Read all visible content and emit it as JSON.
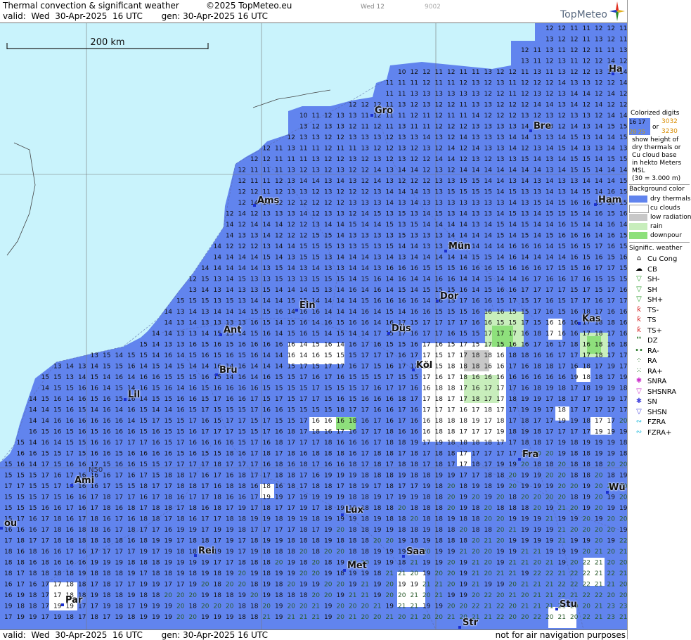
{
  "header": {
    "title": "Thermal convection & significant weather",
    "copyright": "©2025 TopMeteo.eu",
    "valid_line": "valid:  Wed  30-Apr-2025  16 UTC       gen: 30-Apr-2025 16 UTC",
    "tag_a": "Wed 12",
    "tag_b": "9002",
    "logo_text": "TopMeteo"
  },
  "map": {
    "scale_label": "200 km",
    "grid_label": "N50",
    "cities": [
      {
        "id": "gro",
        "name": "Gro"
      },
      {
        "id": "bre",
        "name": "Bre"
      },
      {
        "id": "ha",
        "name": "Ha"
      },
      {
        "id": "ams",
        "name": "Ams"
      },
      {
        "id": "ham",
        "name": "Ham"
      },
      {
        "id": "mun",
        "name": "Mün"
      },
      {
        "id": "dor",
        "name": "Dor"
      },
      {
        "id": "ein",
        "name": "Ein"
      },
      {
        "id": "kas",
        "name": "Kas"
      },
      {
        "id": "ant",
        "name": "Ant"
      },
      {
        "id": "dus",
        "name": "Düs"
      },
      {
        "id": "kol",
        "name": "Köl"
      },
      {
        "id": "bru",
        "name": "Bru"
      },
      {
        "id": "lil",
        "name": "Lil"
      },
      {
        "id": "fra",
        "name": "Fra"
      },
      {
        "id": "ami",
        "name": "Ami"
      },
      {
        "id": "wu",
        "name": "Wü"
      },
      {
        "id": "lux",
        "name": "Lux"
      },
      {
        "id": "rei",
        "name": "Rei"
      },
      {
        "id": "saa",
        "name": "Saa"
      },
      {
        "id": "met",
        "name": "Met"
      },
      {
        "id": "par",
        "name": "Par"
      },
      {
        "id": "stu",
        "name": "Stu"
      },
      {
        "id": "str",
        "name": "Str"
      },
      {
        "id": "ou",
        "name": "ou"
      }
    ]
  },
  "footer": {
    "valid_line": "valid:  Wed  30-Apr-2025  16 UTC       gen: 30-Apr-2025 16 UTC",
    "disclaimer": "not for air navigation purposes"
  },
  "legend": {
    "digits_title": "Colorized digits",
    "digit_sample_a": "16  17",
    "digit_sample_b": "28 25",
    "digit_or": "or",
    "digit_orange_a": "3032",
    "digit_orange_b": "3230",
    "digits_desc": [
      "show height of",
      "dry thermals or",
      "Cu cloud base",
      "in hekto Meters",
      "MSL",
      "(30 = 3.000 m)"
    ],
    "bg_title": "Background color",
    "bg_items": [
      {
        "label": "dry thermals",
        "color": "#6184ee"
      },
      {
        "label": "cu clouds",
        "color": "#ffffff"
      },
      {
        "label": "low radiation",
        "color": "#c8c8c8"
      },
      {
        "label": "rain",
        "color": "#c8eebc"
      },
      {
        "label": "downpour",
        "color": "#8ee07c"
      }
    ],
    "wx_title": "Signific. weather",
    "wx_items": [
      {
        "label": "Cu Cong",
        "symbol": "⌂",
        "color": "#000000"
      },
      {
        "label": "CB",
        "symbol": "☁",
        "color": "#000000"
      },
      {
        "label": "SH-",
        "symbol": "▽",
        "color": "#2d9d2d"
      },
      {
        "label": "SH",
        "symbol": "▽",
        "color": "#2d9d2d"
      },
      {
        "label": "SH+",
        "symbol": "▽",
        "color": "#2d9d2d"
      },
      {
        "label": "TS-",
        "symbol": "ƙ",
        "color": "#d42020"
      },
      {
        "label": "TS",
        "symbol": "ƙ",
        "color": "#d42020"
      },
      {
        "label": "TS+",
        "symbol": "ƙ",
        "color": "#d42020"
      },
      {
        "label": "DZ",
        "symbol": "❜❜",
        "color": "#1a6e1a"
      },
      {
        "label": "RA-",
        "symbol": "••",
        "color": "#1a6e1a"
      },
      {
        "label": "RA",
        "symbol": "⁘",
        "color": "#1a6e1a"
      },
      {
        "label": "RA+",
        "symbol": "⁙",
        "color": "#1a6e1a"
      },
      {
        "label": "SNRA",
        "symbol": "✱",
        "color": "#cc33cc"
      },
      {
        "label": "SHSNRA",
        "symbol": "▽",
        "color": "#cc33cc"
      },
      {
        "label": "SN",
        "symbol": "✱",
        "color": "#4444dd"
      },
      {
        "label": "SHSN",
        "symbol": "▽",
        "color": "#4444dd"
      },
      {
        "label": "FZRA",
        "symbol": "∾",
        "color": "#22bbdd"
      },
      {
        "label": "FZRA+",
        "symbol": "∾",
        "color": "#22bbdd"
      }
    ]
  }
}
